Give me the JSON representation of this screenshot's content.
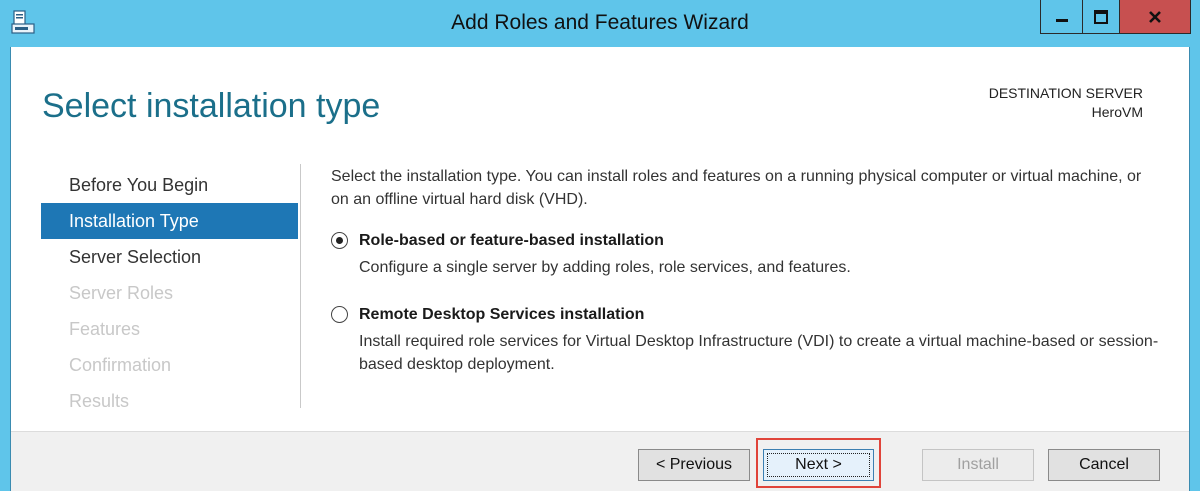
{
  "window": {
    "title": "Add Roles and Features Wizard"
  },
  "header": {
    "page_title": "Select installation type",
    "destination_label": "DESTINATION SERVER",
    "destination_value": "HeroVM"
  },
  "nav": {
    "items": [
      {
        "label": "Before You Begin",
        "state": "normal"
      },
      {
        "label": "Installation Type",
        "state": "active"
      },
      {
        "label": "Server Selection",
        "state": "normal"
      },
      {
        "label": "Server Roles",
        "state": "disabled"
      },
      {
        "label": "Features",
        "state": "disabled"
      },
      {
        "label": "Confirmation",
        "state": "disabled"
      },
      {
        "label": "Results",
        "state": "disabled"
      }
    ]
  },
  "content": {
    "intro": "Select the installation type. You can install roles and features on a running physical computer or virtual machine, or on an offline virtual hard disk (VHD).",
    "options": [
      {
        "label": "Role-based or feature-based installation",
        "description": "Configure a single server by adding roles, role services, and features.",
        "selected": true
      },
      {
        "label": "Remote Desktop Services installation",
        "description": "Install required role services for Virtual Desktop Infrastructure (VDI) to create a virtual machine-based or session-based desktop deployment.",
        "selected": false
      }
    ]
  },
  "footer": {
    "previous_label": "< Previous",
    "next_label": "Next >",
    "install_label": "Install",
    "cancel_label": "Cancel"
  },
  "colors": {
    "titlebar": "#5fc5ea",
    "close_button": "#c75050",
    "title_text": "#1b6f8a",
    "nav_active": "#1e77b5",
    "highlight": "#e0443a"
  },
  "icons": {
    "app": "server-manager-icon",
    "minimize": "minimize-icon",
    "maximize": "maximize-icon",
    "close": "close-icon"
  }
}
